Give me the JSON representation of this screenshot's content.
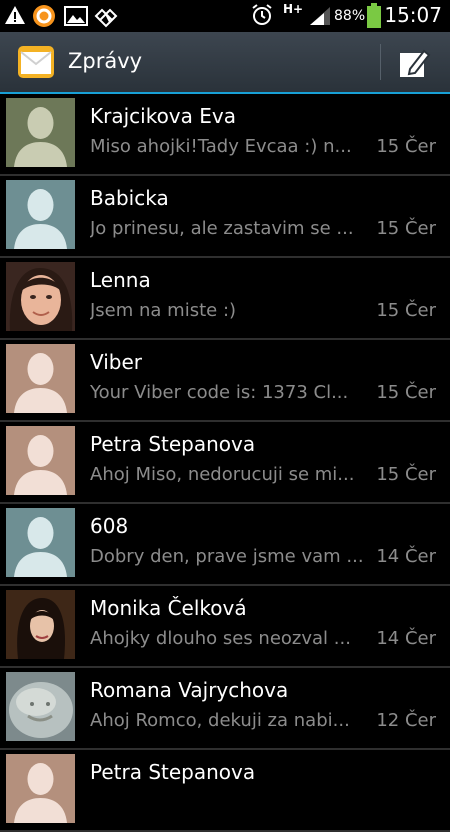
{
  "status_bar": {
    "time": "15:07",
    "battery": "88%",
    "network": "H+",
    "icons": [
      "warning-icon",
      "avast-icon",
      "gallery-icon",
      "dropbox-icon",
      "alarm-icon",
      "signal-icon",
      "battery-icon"
    ]
  },
  "header": {
    "title": "Zprávy",
    "app_icon": "envelope-icon",
    "compose_icon": "compose-icon"
  },
  "threads": [
    {
      "name": "Krajcikova Eva",
      "preview": "Miso ahojki!Tady Evcaa :) n...",
      "date": "15 Čer",
      "avatar": "placeholder",
      "bg": "#6d7858",
      "fg": "#c9ccb2"
    },
    {
      "name": "Babicka",
      "preview": "Jo prinesu, ale zastavim se ...",
      "date": "15 Čer",
      "avatar": "placeholder",
      "bg": "#6e8f93",
      "fg": "#d8e8ea"
    },
    {
      "name": "Lenna",
      "preview": "Jsem na miste :)",
      "date": "15 Čer",
      "avatar": "photo-woman"
    },
    {
      "name": "Viber",
      "preview": "Your Viber code is: 1373 Cl...",
      "date": "15 Čer",
      "avatar": "placeholder",
      "bg": "#b4907d",
      "fg": "#f2dfd6"
    },
    {
      "name": "Petra Stepanova",
      "preview": "Ahoj Miso, nedorucuji se mi...",
      "date": "15 Čer",
      "avatar": "placeholder",
      "bg": "#b4907d",
      "fg": "#f2dfd6"
    },
    {
      "name": "608",
      "preview": "Dobry den, prave jsme vam ...",
      "date": "14 Čer",
      "avatar": "placeholder",
      "bg": "#6e8f93",
      "fg": "#d8e8ea"
    },
    {
      "name": "Monika Čelková",
      "preview": "Ahojky dlouho ses neozval ...",
      "date": "14 Čer",
      "avatar": "photo-dark"
    },
    {
      "name": "Romana Vajrychova",
      "preview": "Ahoj Romco, dekuji za nabi...",
      "date": "12 Čer",
      "avatar": "photo-stone"
    },
    {
      "name": "Petra Stepanova",
      "preview": "",
      "date": "",
      "avatar": "placeholder",
      "bg": "#b4907d",
      "fg": "#f2dfd6"
    }
  ],
  "colors": {
    "accent": "#18a0d6",
    "preview_text": "#8c8c8c",
    "divider": "#2f2f2f"
  }
}
